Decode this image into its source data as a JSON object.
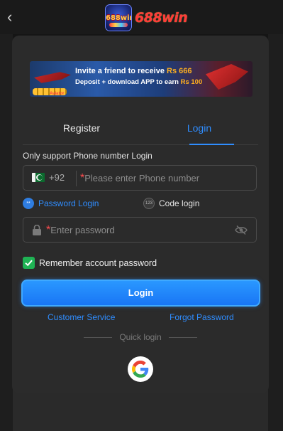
{
  "header": {
    "back_icon": "chevron-left-icon",
    "badge_text": "688win",
    "logo_text": "688win"
  },
  "banner": {
    "line1_prefix": "Invite a friend to receive",
    "line1_amount": "Rs 666",
    "line2_prefix": "Deposit + download APP to earn",
    "line2_amount": "Rs 100",
    "tag": "Aviator"
  },
  "tabs": {
    "register": "Register",
    "login": "Login",
    "active": "login"
  },
  "form": {
    "hint": "Only support Phone number Login",
    "country_code": "+92",
    "phone_required": "*",
    "phone_placeholder": "Please enter Phone number",
    "password_mode_label": "Password Login",
    "password_mode_icon": "**",
    "code_mode_label": "Code login",
    "code_mode_icon": "123",
    "password_required": "*",
    "password_placeholder": "Enter password",
    "remember_label": "Remember account password",
    "remember_checked": true,
    "login_button": "Login"
  },
  "links": {
    "customer_service": "Customer Service",
    "forgot_password": "Forgot Password"
  },
  "quick_login": {
    "label": "Quick login",
    "providers": [
      "google"
    ]
  },
  "colors": {
    "accent": "#2f8dff",
    "check": "#1fb254",
    "required": "#ff4d4f",
    "card": "#2b2b2b"
  }
}
